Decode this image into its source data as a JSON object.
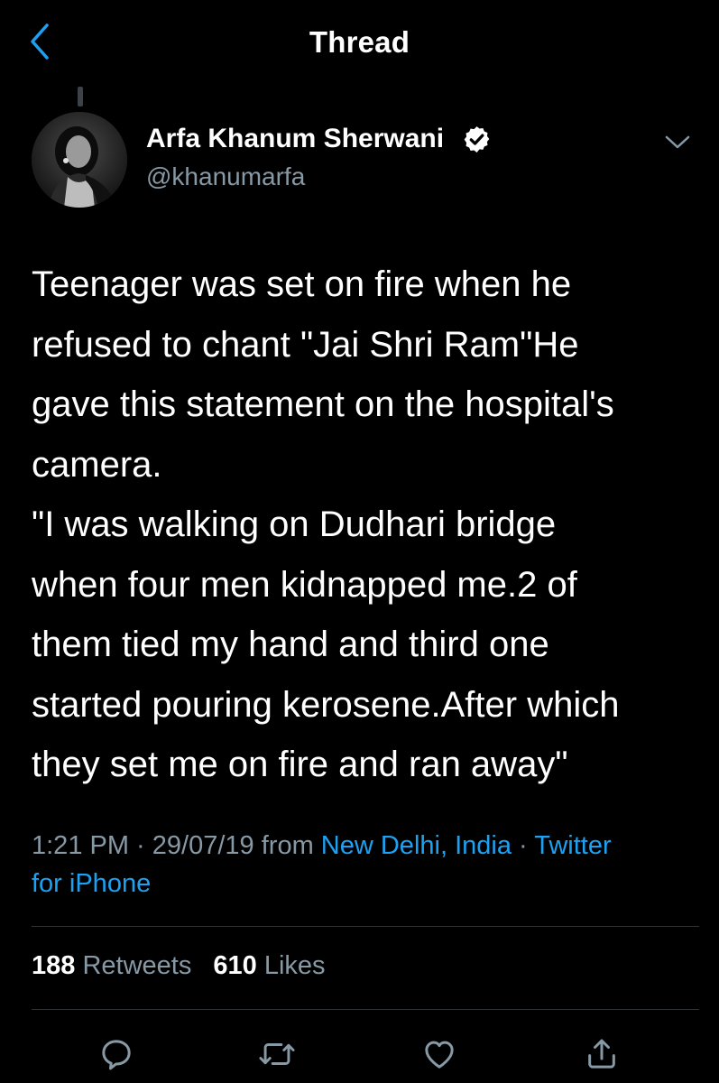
{
  "nav": {
    "title": "Thread",
    "back_icon": "chevron-left-icon"
  },
  "author": {
    "name": "Arfa Khanum Sherwani",
    "handle": "@khanumarfa",
    "verified_icon": "verified-badge-icon"
  },
  "tweet": {
    "lines": [
      "Teenager was set on fire when he",
      "refused to chant \"Jai Shri Ram\"He",
      "gave this statement on the hospital's",
      "camera.",
      "\"I was walking on Dudhari bridge",
      "when four men kidnapped me.2 of",
      "them tied my hand and third one",
      "started pouring kerosene.After which",
      "they set me on fire and ran away\""
    ]
  },
  "meta": {
    "time": "1:21 PM",
    "sep1": " · ",
    "date": "29/07/19",
    "from": " from ",
    "location": "New Delhi, India",
    "sep2": " · ",
    "client_part1": "Twitter",
    "client_part2": "for iPhone"
  },
  "stats": {
    "retweets_count": "188",
    "retweets_label": "Retweets",
    "likes_count": "610",
    "likes_label": "Likes"
  },
  "actions": [
    "reply-icon",
    "retweet-icon",
    "like-icon",
    "share-icon"
  ],
  "colors": {
    "background": "#000000",
    "text": "#ffffff",
    "secondary": "#8899a6",
    "accent": "#1da1f2",
    "divider": "#2f3336"
  }
}
